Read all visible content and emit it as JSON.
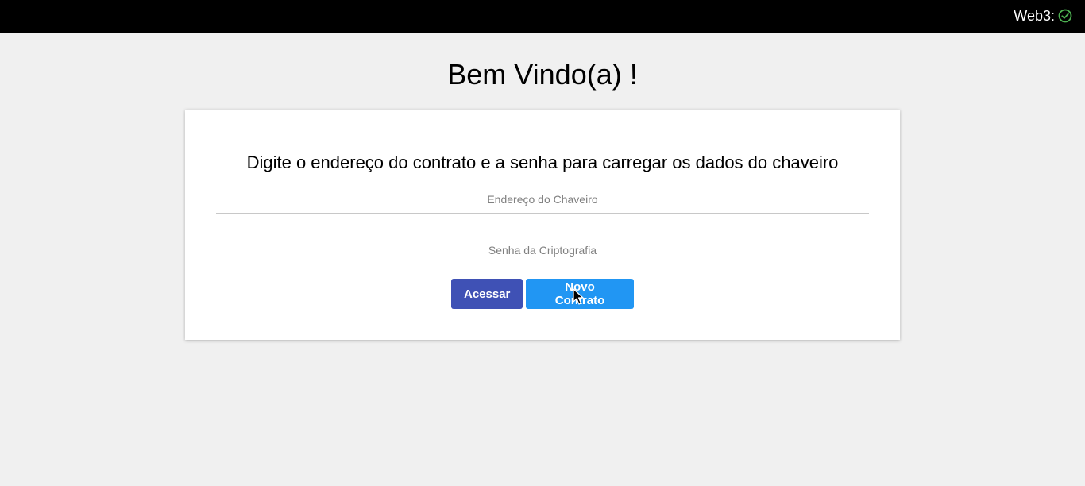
{
  "topbar": {
    "web3_label": "Web3:",
    "web3_status_icon": "check-circle-icon",
    "web3_status_color": "#4caf50"
  },
  "page": {
    "title": "Bem Vindo(a) !"
  },
  "card": {
    "instructions": "Digite o endereço do contrato e a senha para carregar os dados do chaveiro",
    "address_field": {
      "placeholder": "Endereço do Chaveiro",
      "value": ""
    },
    "password_field": {
      "placeholder": "Senha da Criptografia",
      "value": ""
    },
    "access_button_label": "Acessar",
    "new_contract_button_label": "Novo Contrato"
  },
  "colors": {
    "topbar_bg": "#000000",
    "primary_button": "#3f51b5",
    "secondary_button": "#2196f3",
    "page_bg": "#f0f0f0"
  }
}
